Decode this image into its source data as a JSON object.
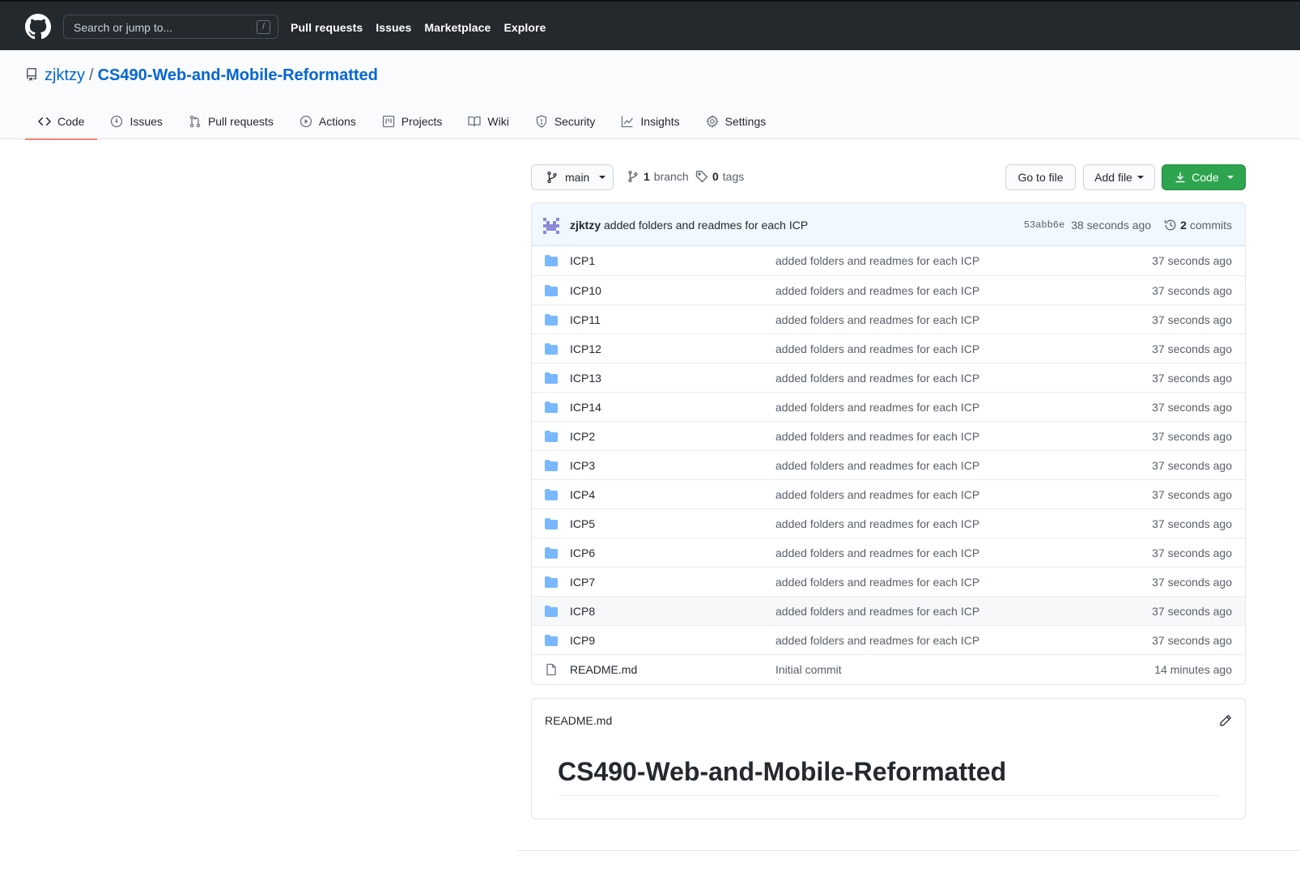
{
  "header": {
    "search_placeholder": "Search or jump to...",
    "search_key": "/",
    "nav": [
      "Pull requests",
      "Issues",
      "Marketplace",
      "Explore"
    ]
  },
  "repo": {
    "owner": "zjktzy",
    "separator": "/",
    "name": "CS490-Web-and-Mobile-Reformatted"
  },
  "tabs": [
    {
      "label": "Code",
      "icon": "code-icon"
    },
    {
      "label": "Issues",
      "icon": "issue-icon"
    },
    {
      "label": "Pull requests",
      "icon": "pull-request-icon"
    },
    {
      "label": "Actions",
      "icon": "play-icon"
    },
    {
      "label": "Projects",
      "icon": "project-icon"
    },
    {
      "label": "Wiki",
      "icon": "book-icon"
    },
    {
      "label": "Security",
      "icon": "shield-icon"
    },
    {
      "label": "Insights",
      "icon": "graph-icon"
    },
    {
      "label": "Settings",
      "icon": "gear-icon"
    }
  ],
  "branch_bar": {
    "branch": "main",
    "branch_count": "1",
    "branch_label": "branch",
    "tag_count": "0",
    "tag_label": "tags",
    "go_to_file": "Go to file",
    "add_file": "Add file",
    "code": "Code"
  },
  "latest_commit": {
    "author": "zjktzy",
    "message": "added folders and readmes for each ICP",
    "sha": "53abb6e",
    "age": "38 seconds ago",
    "commit_count": "2",
    "commit_label": "commits"
  },
  "files": [
    {
      "name": "ICP1",
      "type": "folder",
      "message": "added folders and readmes for each ICP",
      "age": "37 seconds ago"
    },
    {
      "name": "ICP10",
      "type": "folder",
      "message": "added folders and readmes for each ICP",
      "age": "37 seconds ago"
    },
    {
      "name": "ICP11",
      "type": "folder",
      "message": "added folders and readmes for each ICP",
      "age": "37 seconds ago"
    },
    {
      "name": "ICP12",
      "type": "folder",
      "message": "added folders and readmes for each ICP",
      "age": "37 seconds ago"
    },
    {
      "name": "ICP13",
      "type": "folder",
      "message": "added folders and readmes for each ICP",
      "age": "37 seconds ago"
    },
    {
      "name": "ICP14",
      "type": "folder",
      "message": "added folders and readmes for each ICP",
      "age": "37 seconds ago"
    },
    {
      "name": "ICP2",
      "type": "folder",
      "message": "added folders and readmes for each ICP",
      "age": "37 seconds ago"
    },
    {
      "name": "ICP3",
      "type": "folder",
      "message": "added folders and readmes for each ICP",
      "age": "37 seconds ago"
    },
    {
      "name": "ICP4",
      "type": "folder",
      "message": "added folders and readmes for each ICP",
      "age": "37 seconds ago"
    },
    {
      "name": "ICP5",
      "type": "folder",
      "message": "added folders and readmes for each ICP",
      "age": "37 seconds ago"
    },
    {
      "name": "ICP6",
      "type": "folder",
      "message": "added folders and readmes for each ICP",
      "age": "37 seconds ago"
    },
    {
      "name": "ICP7",
      "type": "folder",
      "message": "added folders and readmes for each ICP",
      "age": "37 seconds ago"
    },
    {
      "name": "ICP8",
      "type": "folder",
      "message": "added folders and readmes for each ICP",
      "age": "37 seconds ago"
    },
    {
      "name": "ICP9",
      "type": "folder",
      "message": "added folders and readmes for each ICP",
      "age": "37 seconds ago"
    },
    {
      "name": "README.md",
      "type": "file",
      "message": "Initial commit",
      "age": "14 minutes ago"
    }
  ],
  "readme": {
    "filename": "README.md",
    "heading": "CS490-Web-and-Mobile-Reformatted"
  },
  "colors": {
    "header_bg": "#24292e",
    "link": "#0366d6",
    "active_tab_underline": "#f9826c",
    "code_button": "#2ea44f",
    "folder": "#79b8ff"
  }
}
